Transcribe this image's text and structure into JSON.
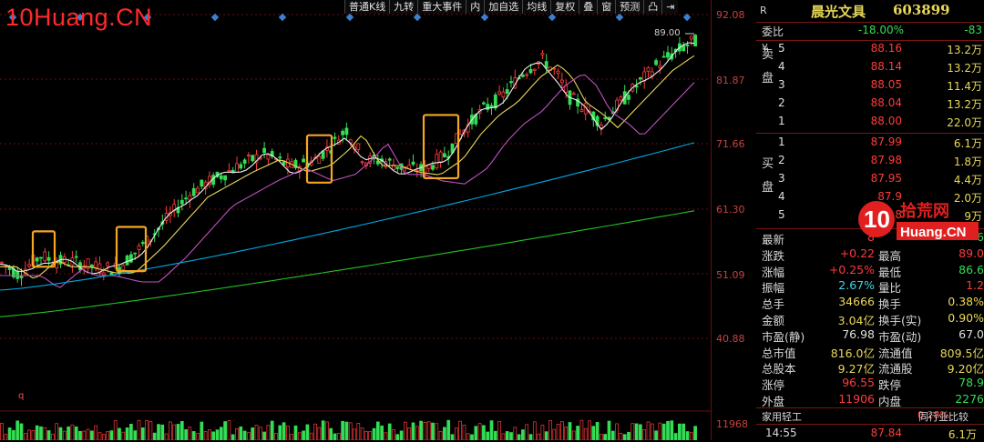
{
  "watermark": "10Huang.CN",
  "toolbar": [
    "普通K线",
    "九转",
    "重大事件",
    "内",
    "加自选",
    "均线",
    "复权",
    "叠",
    "窗",
    "预测",
    "凸",
    "⇥"
  ],
  "price_axis": [
    {
      "label": "92.08",
      "value": 92.08
    },
    {
      "label": "81.87",
      "value": 81.87
    },
    {
      "label": "71.66",
      "value": 71.66
    },
    {
      "label": "61.30",
      "value": 61.3
    },
    {
      "label": "51.09",
      "value": 51.09
    },
    {
      "label": "40.88",
      "value": 40.88
    },
    {
      "label": "11968",
      "value": 11968
    }
  ],
  "high_marker": "89.00",
  "q_label": "q",
  "colors": {
    "up": "#ff3b3b",
    "down": "#33dd55",
    "ma5": "#f0f0f0",
    "ma10": "#e8d85a",
    "ma20": "#c050c0",
    "ma60": "#00a8e0",
    "ma120": "#22c022",
    "highlight": "#f5a623",
    "grid": "#6b0e0e"
  },
  "chart_data": {
    "type": "candlestick",
    "ylim": [
      40.88,
      92.08
    ],
    "highlight_boxes": [
      {
        "from_price": 52.2,
        "to_price": 57.8
      },
      {
        "from_price": 51.5,
        "to_price": 58.5
      },
      {
        "from_price": 65.5,
        "to_price": 73.0
      },
      {
        "from_price": 66.2,
        "to_price": 76.2
      }
    ],
    "ma_levels": {
      "ma60": [
        [
          0,
          48.5
        ],
        [
          780,
          72.5
        ]
      ],
      "ma120": [
        [
          0,
          44.3
        ],
        [
          780,
          61.5
        ]
      ]
    }
  },
  "quote": {
    "r_mark": "R",
    "name": "晨光文具",
    "code": "603899",
    "webi_label": "委比",
    "webi_value": "-18.00%",
    "webi_diff": "-83",
    "sell_side": "卖盘",
    "buy_side": "买盘",
    "yen": "¥",
    "sell": [
      {
        "level": "5",
        "price": "88.16",
        "volume": "13.2万"
      },
      {
        "level": "4",
        "price": "88.14",
        "volume": "13.2万"
      },
      {
        "level": "3",
        "price": "88.05",
        "volume": "11.4万"
      },
      {
        "level": "2",
        "price": "88.04",
        "volume": "13.2万"
      },
      {
        "level": "1",
        "price": "88.00",
        "volume": "22.0万"
      }
    ],
    "buy": [
      {
        "level": "1",
        "price": "87.99",
        "volume": "6.1万"
      },
      {
        "level": "2",
        "price": "87.98",
        "volume": "1.8万"
      },
      {
        "level": "3",
        "price": "87.95",
        "volume": "4.4万"
      },
      {
        "level": "4",
        "price": "87.9",
        "volume": "2.0万"
      },
      {
        "level": "5",
        "price": "8",
        "volume": "9万"
      }
    ],
    "stats": [
      {
        "l1": "最新",
        "v1": "8",
        "l2": "",
        "v2": "6",
        "c1": "red",
        "c2": "green"
      },
      {
        "l1": "涨跌",
        "v1": "+0.22",
        "l2": "最高",
        "v2": "89.0",
        "c1": "red",
        "c2": "red"
      },
      {
        "l1": "涨幅",
        "v1": "+0.25%",
        "l2": "最低",
        "v2": "86.6",
        "c1": "red",
        "c2": "green"
      },
      {
        "l1": "振幅",
        "v1": "2.67%",
        "l2": "量比",
        "v2": "1.2",
        "c1": "cyan",
        "c2": "red"
      },
      {
        "l1": "总手",
        "v1": "34666",
        "l2": "换手",
        "v2": "0.38%",
        "c1": "yellow",
        "c2": "yellow"
      },
      {
        "l1": "金额",
        "v1": "3.04亿",
        "l2": "换手(实)",
        "v2": "0.90%",
        "c1": "yellow",
        "c2": "yellow"
      },
      {
        "l1": "市盈(静)",
        "v1": "76.98",
        "l2": "市盈(动)",
        "v2": "67.0",
        "c1": "white",
        "c2": "white"
      },
      {
        "l1": "总市值",
        "v1": "816.0亿",
        "l2": "流通值",
        "v2": "809.5亿",
        "c1": "yellow",
        "c2": "yellow"
      },
      {
        "l1": "总股本",
        "v1": "9.27亿",
        "l2": "流通股",
        "v2": "9.20亿",
        "c1": "yellow",
        "c2": "yellow"
      },
      {
        "l1": "涨停",
        "v1": "96.55",
        "l2": "跌停",
        "v2": "78.9",
        "c1": "red",
        "c2": "green"
      },
      {
        "l1": "外盘",
        "v1": "11906",
        "l2": "内盘",
        "v2": "2276",
        "c1": "red",
        "c2": "green"
      }
    ],
    "industry": "家用轻工",
    "industry_change": "0.28%",
    "industry_compare": "同行业比较",
    "last_time": "14:55",
    "last_price": "87.84",
    "last_vol": "6.1万",
    "logo_text1": "拾荒网",
    "logo_text2": "Huang.CN",
    "logo_num": "10"
  }
}
